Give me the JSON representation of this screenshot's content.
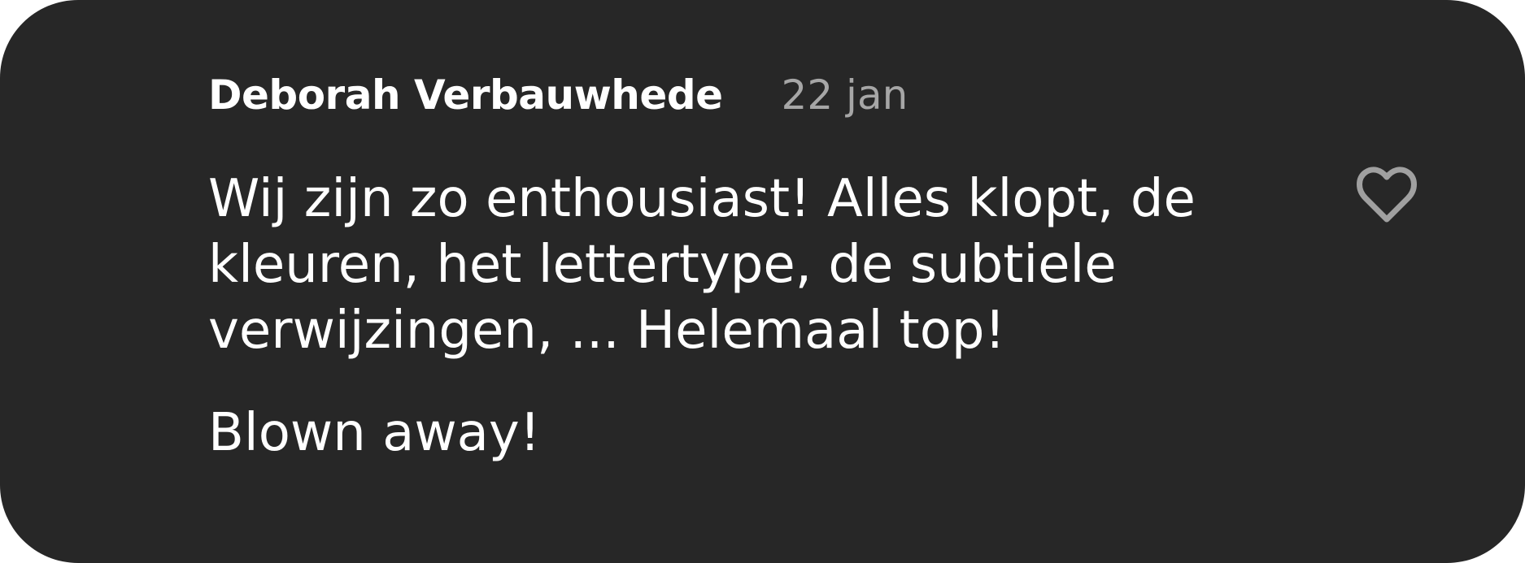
{
  "comment": {
    "author": "Deborah Verbauwhede",
    "date": "22 jan",
    "paragraphs": [
      "Wij zijn zo enthousiast! Alles klopt, de kleuren, het lettertype, de subtiele verwijzingen, ... Helemaal top!",
      "Blown away!"
    ],
    "like_icon": "heart-outline-icon"
  },
  "colors": {
    "background": "#272727",
    "text": "#ffffff",
    "muted": "#a6a6a6",
    "icon": "#a0a0a0"
  }
}
